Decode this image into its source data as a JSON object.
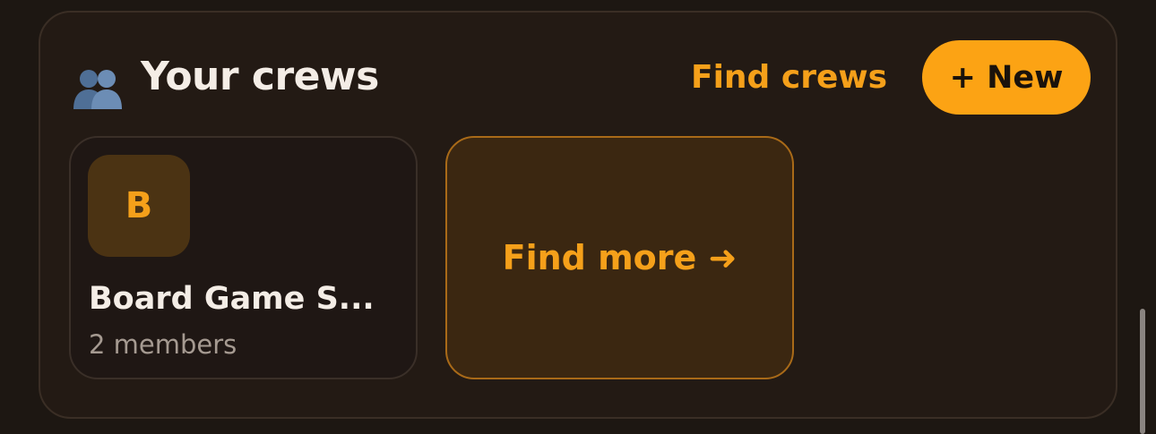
{
  "crews_section": {
    "icon": "busts-in-silhouette-icon",
    "title": "Your crews",
    "find_crews_label": "Find crews",
    "new_button_label": "+ New"
  },
  "crews": [
    {
      "avatar_letter": "B",
      "name": "Board Game S...",
      "members": "2 members"
    }
  ],
  "find_more_label": "Find more ➜",
  "colors": {
    "accent": "#fca314",
    "accent_text": "#f5a01a",
    "background": "#1d1712",
    "panel": "#231a14",
    "text": "#f4ede6",
    "muted_text": "#a59a91"
  }
}
